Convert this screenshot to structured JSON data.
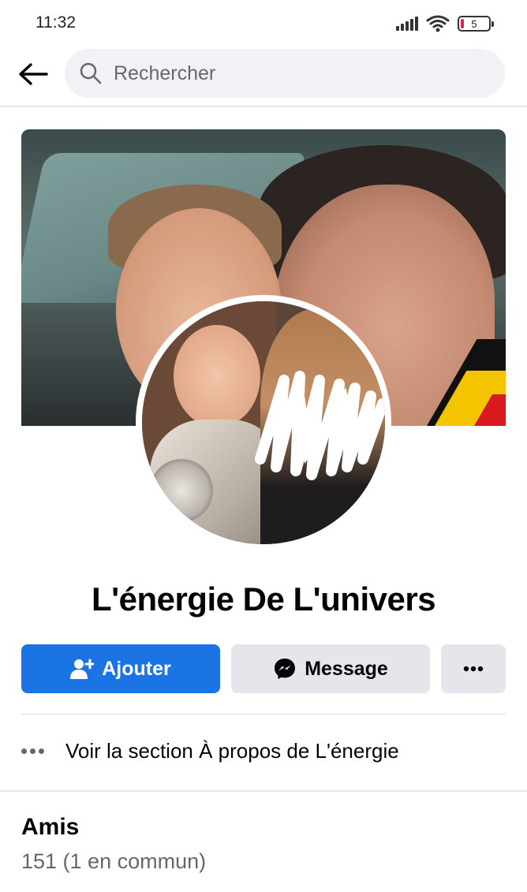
{
  "status_bar": {
    "time": "11:32",
    "battery_level": "5"
  },
  "top_nav": {
    "search_placeholder": "Rechercher"
  },
  "profile": {
    "name": "L'énergie De L'univers"
  },
  "actions": {
    "add_label": "Ajouter",
    "message_label": "Message"
  },
  "about": {
    "text": "Voir la section À propos de L'énergie"
  },
  "friends": {
    "title": "Amis",
    "count": "151 (1 en commun)"
  },
  "colors": {
    "primary": "#1b74e4",
    "button_secondary": "#e4e6eb",
    "text_secondary": "#65676b",
    "search_bg": "#f0f2f5"
  }
}
